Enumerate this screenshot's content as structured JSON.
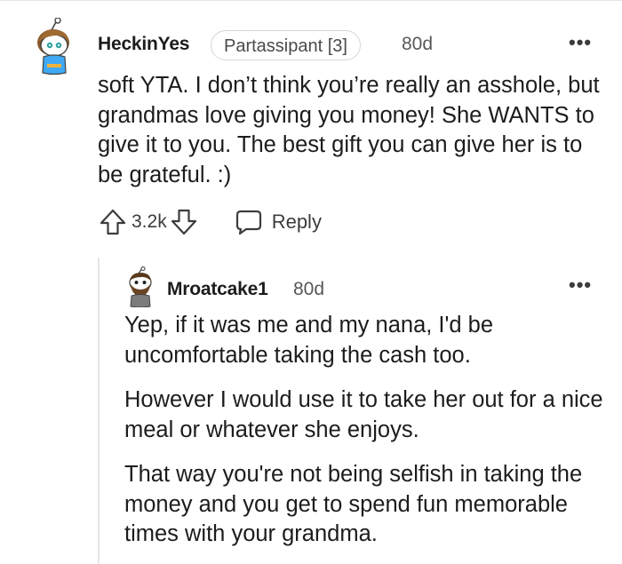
{
  "comment": {
    "author": "HeckinYes",
    "flair": "Partassipant [3]",
    "age": "80d",
    "more_label": "•••",
    "body": "soft YTA. I don’t think you’re really an asshole, but grandmas love giving you money! She WANTS to give it to you. The best gift you can give her is to be grateful. :)",
    "score": "3.2k",
    "reply_label": "Reply",
    "avatar_icon": "snoo-avatar-blue-shirt-icon"
  },
  "reply": {
    "author": "Mroatcake1",
    "age": "80d",
    "more_label": "•••",
    "paragraphs": [
      "Yep, if it was me and my nana, I'd be uncomfortable taking the cash too.",
      "However I would use it to take her out for a nice meal or whatever she enjoys.",
      "That way you're not being selfish in taking the money and you get to spend fun memorable times with your grandma."
    ],
    "avatar_icon": "snoo-avatar-bearded-icon"
  },
  "icons": {
    "upvote": "upvote-arrow-icon",
    "downvote": "downvote-arrow-icon",
    "reply": "speech-bubble-icon",
    "more": "more-options-icon"
  },
  "colors": {
    "text": "#1c1c1c",
    "muted": "#575757",
    "flair_border": "#d3d6da",
    "thread_line": "#e6e6e6",
    "avatar_shirt": "#3fa9f5"
  }
}
